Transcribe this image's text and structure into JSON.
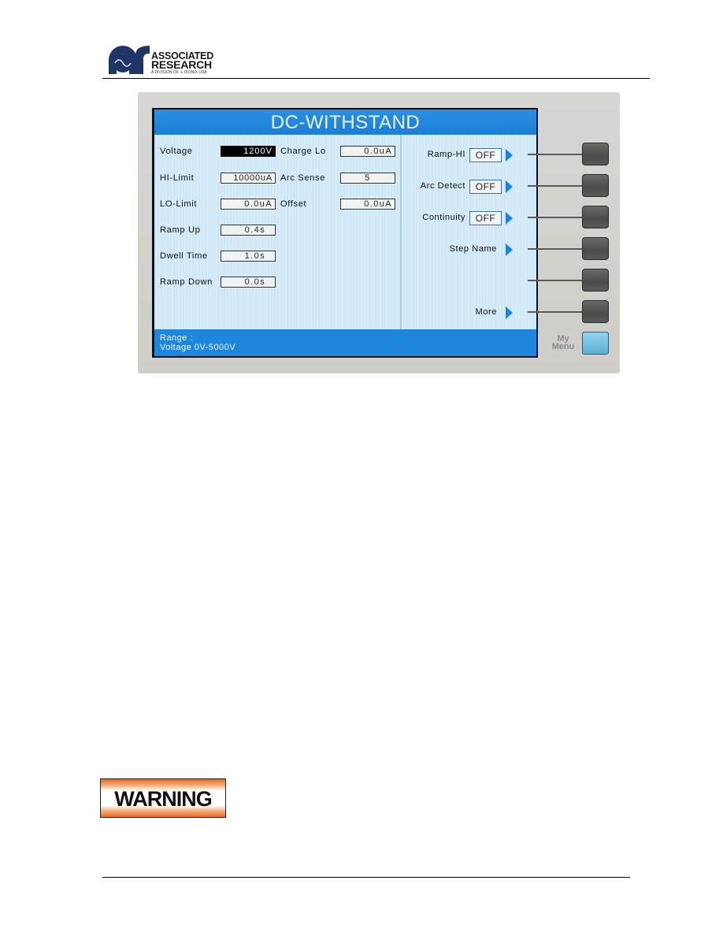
{
  "header": {
    "brand_line1": "ASSOCIATED",
    "brand_line2": "RESEARCH",
    "brand_sub": "A DIVISION OF ⚠ IKONIX USA"
  },
  "screen": {
    "title": "DC-WITHSTAND",
    "parameters_left": [
      {
        "label": "Voltage",
        "value": "1200V",
        "selected": true
      },
      {
        "label": "HI-Limit",
        "value": "10000uA"
      },
      {
        "label": "LO-Limit",
        "value": "0.0uA"
      },
      {
        "label": "Ramp Up",
        "value": "0.4s"
      },
      {
        "label": "Dwell Time",
        "value": "1.0s"
      },
      {
        "label": "Ramp Down",
        "value": "0.0s"
      }
    ],
    "parameters_mid": [
      {
        "label": "Charge Lo",
        "value": "0.0uA"
      },
      {
        "label": "Arc Sense",
        "value": "5"
      },
      {
        "label": "Offset",
        "value": "0.0uA"
      }
    ],
    "softkey_menu": [
      {
        "label": "Ramp-HI",
        "value": "OFF"
      },
      {
        "label": "Arc Detect",
        "value": "OFF"
      },
      {
        "label": "Continuity",
        "value": "OFF"
      },
      {
        "label": "Step Name"
      },
      {
        "label": ""
      },
      {
        "label": "More"
      }
    ],
    "status": {
      "line1": "Range  :",
      "line2": "Voltage 0V-5000V"
    }
  },
  "panel": {
    "my_menu_label_1": "My",
    "my_menu_label_2": "Menu"
  },
  "warning_label": "WARNING",
  "colors": {
    "screen_blue": "#1e86dc",
    "screen_bg": "#cde6f4",
    "warning_orange": "#e56a1f"
  }
}
